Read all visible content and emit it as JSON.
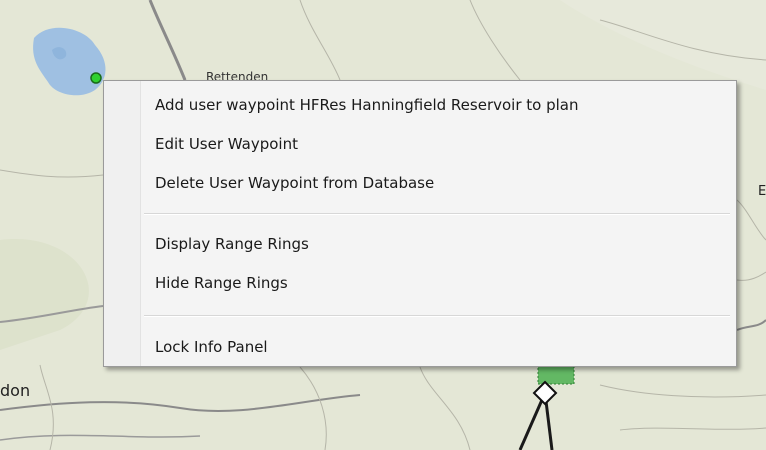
{
  "map": {
    "labels": {
      "place_bottom_left": "don",
      "place_top": "Rettenden",
      "place_right": "E"
    },
    "colors": {
      "land": "#e3e6d4",
      "water": "#9fc0e2",
      "road": "#8a8a8a",
      "waypoint_marker": "#2fd12f",
      "green_area": "#4caf50"
    }
  },
  "context_menu": {
    "items": [
      {
        "label": "Add user waypoint HFRes Hanningfield Reservoir to plan"
      },
      {
        "label": "Edit User Waypoint"
      },
      {
        "label": "Delete User Waypoint from Database"
      },
      {
        "label": "Display Range Rings"
      },
      {
        "label": "Hide Range Rings"
      },
      {
        "label": "Lock Info Panel"
      }
    ]
  }
}
